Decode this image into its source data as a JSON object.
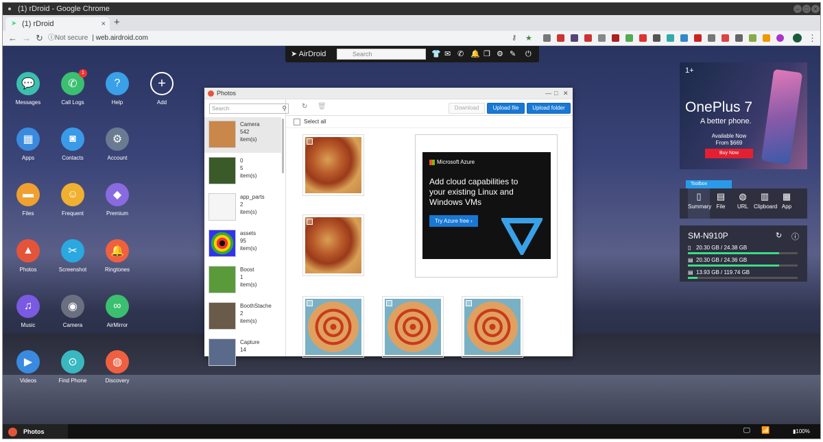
{
  "browser": {
    "title": "(1) rDroid - Google Chrome",
    "tab_label": "(1) rDroid",
    "url_prefix": "Not secure",
    "url": "web.airdroid.com"
  },
  "airdroid_toolbar": {
    "brand": "AirDroid",
    "search_placeholder": "Search"
  },
  "apps": [
    {
      "label": "Messages",
      "icon": "chat-icon",
      "color": "#3cbfae",
      "glyph": "💬"
    },
    {
      "label": "Call Logs",
      "icon": "phone-icon",
      "color": "#3bbf70",
      "glyph": "✆",
      "badge": "1"
    },
    {
      "label": "Help",
      "icon": "question-icon",
      "color": "#3aa0e8",
      "glyph": "?"
    },
    {
      "label": "Add",
      "icon": "plus-icon",
      "color": "transparent",
      "glyph": "+"
    },
    {
      "label": "Apps",
      "icon": "grid-icon",
      "color": "#3a8ae0",
      "glyph": "▦"
    },
    {
      "label": "Contacts",
      "icon": "contact-icon",
      "color": "#3a9ae8",
      "glyph": "◙"
    },
    {
      "label": "Account",
      "icon": "gear-icon",
      "color": "#6a7a90",
      "glyph": "⚙"
    },
    {
      "label": "Files",
      "icon": "folder-icon",
      "color": "#f0a030",
      "glyph": "▬"
    },
    {
      "label": "Frequent",
      "icon": "star-face-icon",
      "color": "#f0b030",
      "glyph": "☺"
    },
    {
      "label": "Premium",
      "icon": "diamond-icon",
      "color": "#8a6ae0",
      "glyph": "◆"
    },
    {
      "label": "Photos",
      "icon": "landscape-icon",
      "color": "#e4543a",
      "glyph": "▲"
    },
    {
      "label": "Screenshot",
      "icon": "scissors-icon",
      "color": "#2aa8e0",
      "glyph": "✂"
    },
    {
      "label": "Ringtones",
      "icon": "bell-icon",
      "color": "#f06040",
      "glyph": "🔔"
    },
    {
      "label": "Music",
      "icon": "music-icon",
      "color": "#7a5ae0",
      "glyph": "♫"
    },
    {
      "label": "Camera",
      "icon": "camera-icon",
      "color": "#6a7080",
      "glyph": "◉"
    },
    {
      "label": "AirMirror",
      "icon": "binoculars-icon",
      "color": "#3bbf70",
      "glyph": "∞"
    },
    {
      "label": "Videos",
      "icon": "play-icon",
      "color": "#3a8ae0",
      "glyph": "▶"
    },
    {
      "label": "Find Phone",
      "icon": "location-icon",
      "color": "#3ab8c0",
      "glyph": "⊙"
    },
    {
      "label": "Discovery",
      "icon": "planet-icon",
      "color": "#f06040",
      "glyph": "◍"
    }
  ],
  "photos_window": {
    "title": "Photos",
    "search_placeholder": "Search",
    "download_label": "Download",
    "upload_file_label": "Upload file",
    "upload_folder_label": "Upload folder",
    "select_all_label": "Select all",
    "albums": [
      {
        "name": "Camera",
        "count": "542",
        "unit": "item(s)"
      },
      {
        "name": "0",
        "count": "5",
        "unit": "item(s)"
      },
      {
        "name": "app_parts",
        "count": "2",
        "unit": "item(s)"
      },
      {
        "name": "assets",
        "count": "95",
        "unit": "item(s)"
      },
      {
        "name": "Boost",
        "count": "1",
        "unit": "item(s)"
      },
      {
        "name": "BoothStache",
        "count": "2",
        "unit": "item(s)"
      },
      {
        "name": "Capture",
        "count": "14",
        "unit": ""
      }
    ]
  },
  "inline_ad": {
    "brand": "Microsoft Azure",
    "headline": "Add cloud capabilities to your existing Linux and Windows VMs",
    "cta": "Try Azure free"
  },
  "right_ad": {
    "model": "OnePlus 7",
    "tagline": "A better phone.",
    "availability": "Available Now",
    "price": "From $669",
    "buy": "Buy Now"
  },
  "toolbox": {
    "label": "Toolbox",
    "items": [
      {
        "label": "Summary",
        "glyph": "▯"
      },
      {
        "label": "File",
        "glyph": "▤"
      },
      {
        "label": "URL",
        "glyph": "◍"
      },
      {
        "label": "Clipboard",
        "glyph": "▥"
      },
      {
        "label": "App",
        "glyph": "▦"
      }
    ]
  },
  "device": {
    "name": "SM-N910P",
    "storage": [
      {
        "text": "20.30 GB / 24.38 GB",
        "fraction": 0.83
      },
      {
        "text": "20.30 GB / 24.36 GB",
        "fraction": 0.83
      },
      {
        "text": "13.93 GB / 119.74 GB",
        "fraction": 0.09
      }
    ]
  },
  "taskbar": {
    "active_app": "Photos",
    "battery": "100%"
  }
}
